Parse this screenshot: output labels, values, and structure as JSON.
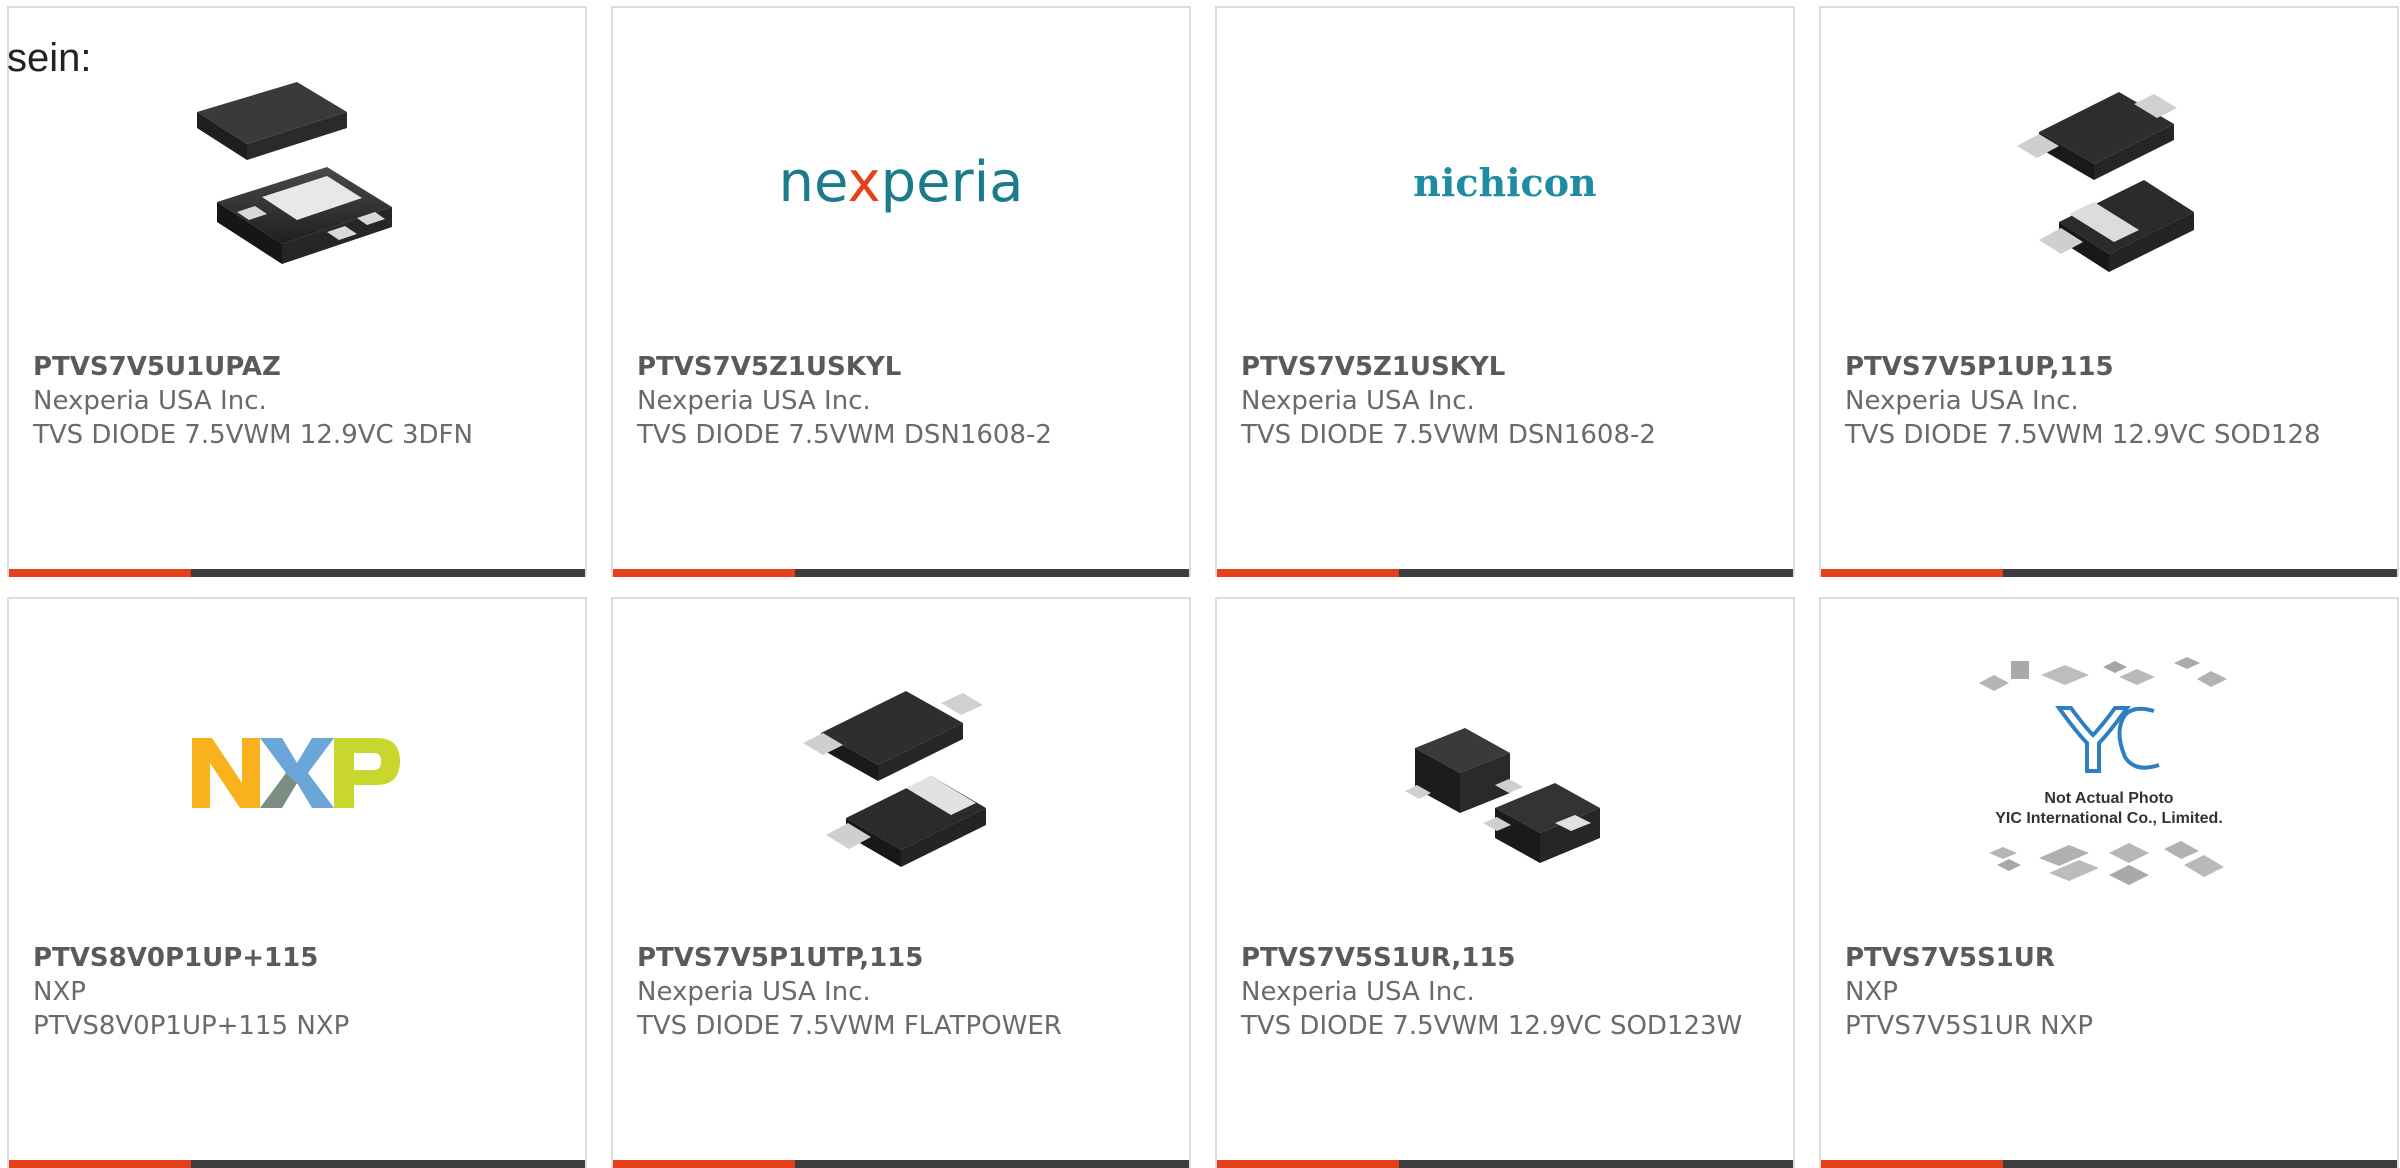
{
  "page_fragment_text": "sein:",
  "accent_color": "#e4401a",
  "bar_color": "#3d3d3d",
  "products": [
    {
      "part_number": "PTVS7V5U1UPAZ",
      "manufacturer": "Nexperia USA Inc.",
      "description": "TVS DIODE 7.5VWM 12.9VC 3DFN",
      "image": "3dfn-package-photo"
    },
    {
      "part_number": "PTVS7V5Z1USKYL",
      "manufacturer": "Nexperia USA Inc.",
      "description": "TVS DIODE 7.5VWM DSN1608-2",
      "image": "nexperia-logo",
      "logo_text_a": "ne",
      "logo_text_x": "x",
      "logo_text_b": "peria"
    },
    {
      "part_number": "PTVS7V5Z1USKYL",
      "manufacturer": "Nexperia USA Inc.",
      "description": "TVS DIODE 7.5VWM DSN1608-2",
      "image": "nichicon-logo",
      "logo_text": "nichicon"
    },
    {
      "part_number": "PTVS7V5P1UP,115",
      "manufacturer": "Nexperia USA Inc.",
      "description": "TVS DIODE 7.5VWM 12.9VC SOD128",
      "image": "sod128-package-photo"
    },
    {
      "part_number": "PTVS8V0P1UP+115",
      "manufacturer": "NXP",
      "description": "PTVS8V0P1UP+115 NXP",
      "image": "nxp-logo"
    },
    {
      "part_number": "PTVS7V5P1UTP,115",
      "manufacturer": "Nexperia USA Inc.",
      "description": "TVS DIODE 7.5VWM FLATPOWER",
      "image": "flatpower-package-photo"
    },
    {
      "part_number": "PTVS7V5S1UR,115",
      "manufacturer": "Nexperia USA Inc.",
      "description": "TVS DIODE 7.5VWM 12.9VC SOD123W",
      "image": "sod123w-package-photo"
    },
    {
      "part_number": "PTVS7V5S1UR",
      "manufacturer": "NXP",
      "description": "PTVS7V5S1UR NXP",
      "image": "yic-placeholder",
      "placeholder_line1": "Not Actual Photo",
      "placeholder_line2": "YIC International Co., Limited."
    }
  ]
}
